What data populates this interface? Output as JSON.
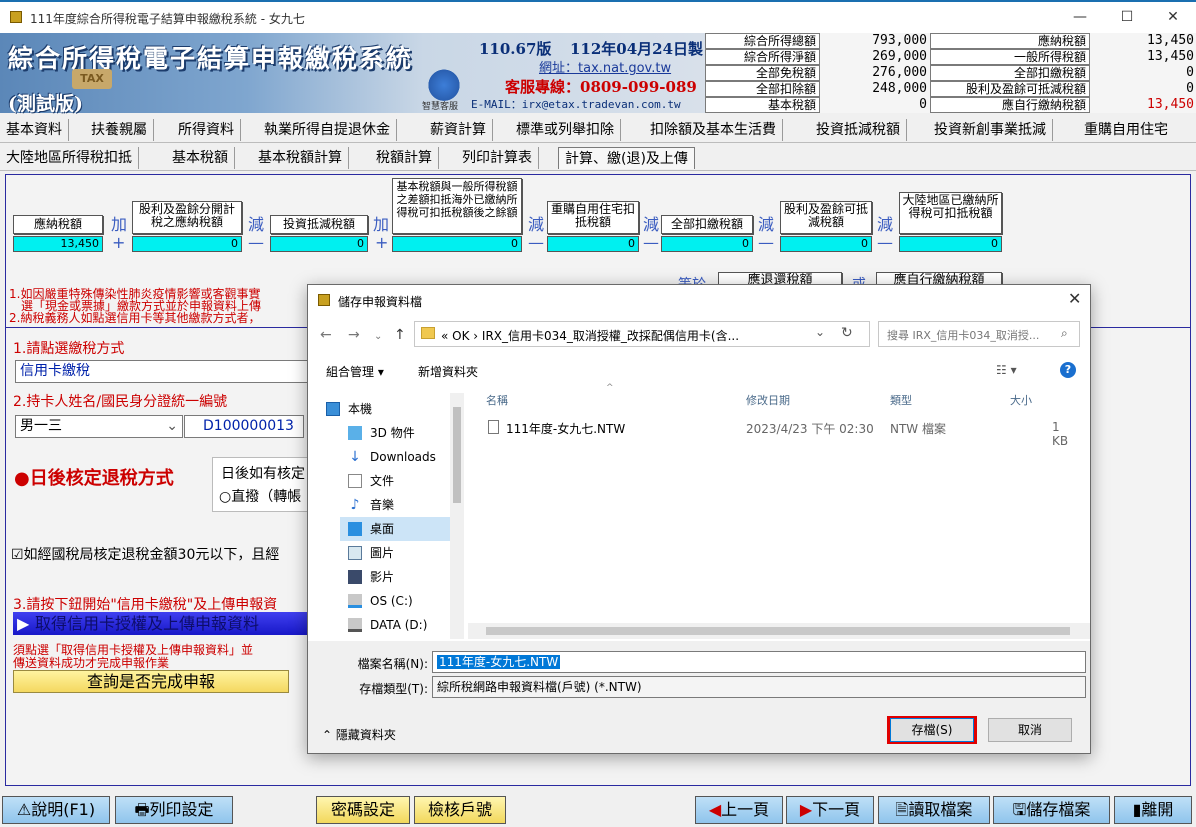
{
  "window": {
    "title": "111年度綜合所得稅電子結算申報繳稅系統 - 女九七",
    "minimize": "—",
    "maximize": "☐",
    "close": "✕"
  },
  "banner": {
    "main_title": "綜合所得稅電子結算申報繳稅系統",
    "test_version": "(測試版)",
    "tax_badge": "TAX",
    "mascot_label": "智慧客服",
    "version": "110.67版",
    "date": "112年04月24日製",
    "website": "網址：tax.nat.gov.tw",
    "hotline": "客服專線：0809-099-089",
    "email": "E-MAIL：irx@etax.tradevan.com.tw"
  },
  "summary": {
    "left": [
      {
        "label": "綜合所得總額",
        "value": "793,000"
      },
      {
        "label": "綜合所得淨額",
        "value": "269,000"
      },
      {
        "label": "全部免稅額",
        "value": "276,000"
      },
      {
        "label": "全部扣除額",
        "value": "248,000"
      },
      {
        "label": "基本稅額",
        "value": "0"
      }
    ],
    "right": [
      {
        "label": "應納稅額",
        "value": "13,450"
      },
      {
        "label": "一般所得稅額",
        "value": "13,450"
      },
      {
        "label": "全部扣繳稅額",
        "value": "0"
      },
      {
        "label": "股利及盈餘可抵減稅額",
        "value": "0"
      },
      {
        "label": "應自行繳納稅額",
        "value": "13,450"
      }
    ]
  },
  "menu_row1": [
    "基本資料",
    "扶養親屬",
    "所得資料",
    "執業所得自提退休金",
    "薪資計算",
    "標準或列舉扣除",
    "扣除額及基本生活費",
    "投資抵減稅額",
    "投資新創事業抵減",
    "重購自用住宅"
  ],
  "menu_row2": [
    "大陸地區所得稅扣抵",
    "基本稅額",
    "基本稅額計算",
    "稅額計算",
    "列印計算表",
    "計算、繳(退)及上傳"
  ],
  "calc": {
    "labels": [
      "應納稅額",
      "股利及盈餘分開計稅之應納稅額",
      "投資抵減稅額",
      "基本稅額與一般所得稅額之差額扣抵海外已繳納所得稅可扣抵稅額後之餘額",
      "重購自用住宅扣抵稅額",
      "全部扣繳稅額",
      "股利及盈餘可抵減稅額",
      "大陸地區已繳納所得稅可扣抵稅額"
    ],
    "values": [
      "13,450",
      "0",
      "0",
      "0",
      "0",
      "0",
      "0",
      "0"
    ],
    "ops_top": [
      "加",
      "減",
      "加",
      "減",
      "減",
      "減",
      "減"
    ],
    "ops_bottom": [
      "+",
      "—",
      "+",
      "—",
      "—",
      "—",
      "—"
    ],
    "equals_label": "等於",
    "refund_label": "應退還稅額",
    "or_label": "或",
    "pay_label": "應自行繳納稅額"
  },
  "notes": {
    "note1a": "1.如因嚴重特殊傳染性肺炎疫情影響或客觀事實",
    "note1b": "選「現金或票據」繳款方式並於申報資料上傳",
    "note2": "2.納稅義務人如點選信用卡等其他繳款方式者，"
  },
  "form": {
    "step1_label": "1.請點選繳稅方式",
    "pay_method": "信用卡繳稅",
    "step2_label": "2.持卡人姓名/國民身分證統一編號",
    "cardholder": "男一三",
    "id_number": "D100000013",
    "refund_method_label": "●日後核定退稅方式",
    "refund_hint": "日後如有核定",
    "refund_option": "○直撥（轉帳",
    "checkbox_text": "☑如經國稅局核定退稅金額30元以下，且經",
    "step3_label": "3.請按下鈕開始\"信用卡繳稅\"及上傳申報資",
    "upload_button": "取得信用卡授權及上傳申報資料",
    "upload_note1": "須點選「取得信用卡授權及上傳申報資料」並",
    "upload_note2": "傳送資料成功才完成申報作業",
    "query_button": "查詢是否完成申報"
  },
  "dialog": {
    "title": "儲存申報資料檔",
    "breadcrumb": "«  OK  ›  IRX_信用卡034_取消授權_改採配偶信用卡(含...",
    "search_placeholder": "搜尋 IRX_信用卡034_取消授...",
    "organize": "組合管理 ▾",
    "new_folder": "新增資料夾",
    "tree": [
      "本機",
      "3D 物件",
      "Downloads",
      "文件",
      "音樂",
      "桌面",
      "圖片",
      "影片",
      "OS (C:)",
      "DATA (D:)"
    ],
    "columns": [
      "名稱",
      "修改日期",
      "類型",
      "大小"
    ],
    "files": [
      {
        "name": "111年度-女九七.NTW",
        "date": "2023/4/23 下午 02:30",
        "type": "NTW 檔案",
        "size": "1 KB"
      }
    ],
    "filename_label": "檔案名稱(N):",
    "filename_value": "111年度-女九七.NTW",
    "filetype_label": "存檔類型(T):",
    "filetype_value": "綜所稅網路申報資料檔(戶號) (*.NTW)",
    "hide_folders": "隱藏資料夾",
    "save_button": "存檔(S)",
    "cancel_button": "取消"
  },
  "bottom_bar": {
    "help": "說明(F1)",
    "print_settings": "列印設定",
    "password": "密碼設定",
    "check_household": "檢核戶號",
    "prev": "上一頁",
    "next": "下一頁",
    "read_file": "讀取檔案",
    "save_file": "儲存檔案",
    "exit": "離開"
  },
  "colors": {
    "accent_blue": "#1a6fb0",
    "field_cyan": "#00f0f0",
    "note_red": "#cc0000",
    "save_highlight": "#e00000"
  }
}
